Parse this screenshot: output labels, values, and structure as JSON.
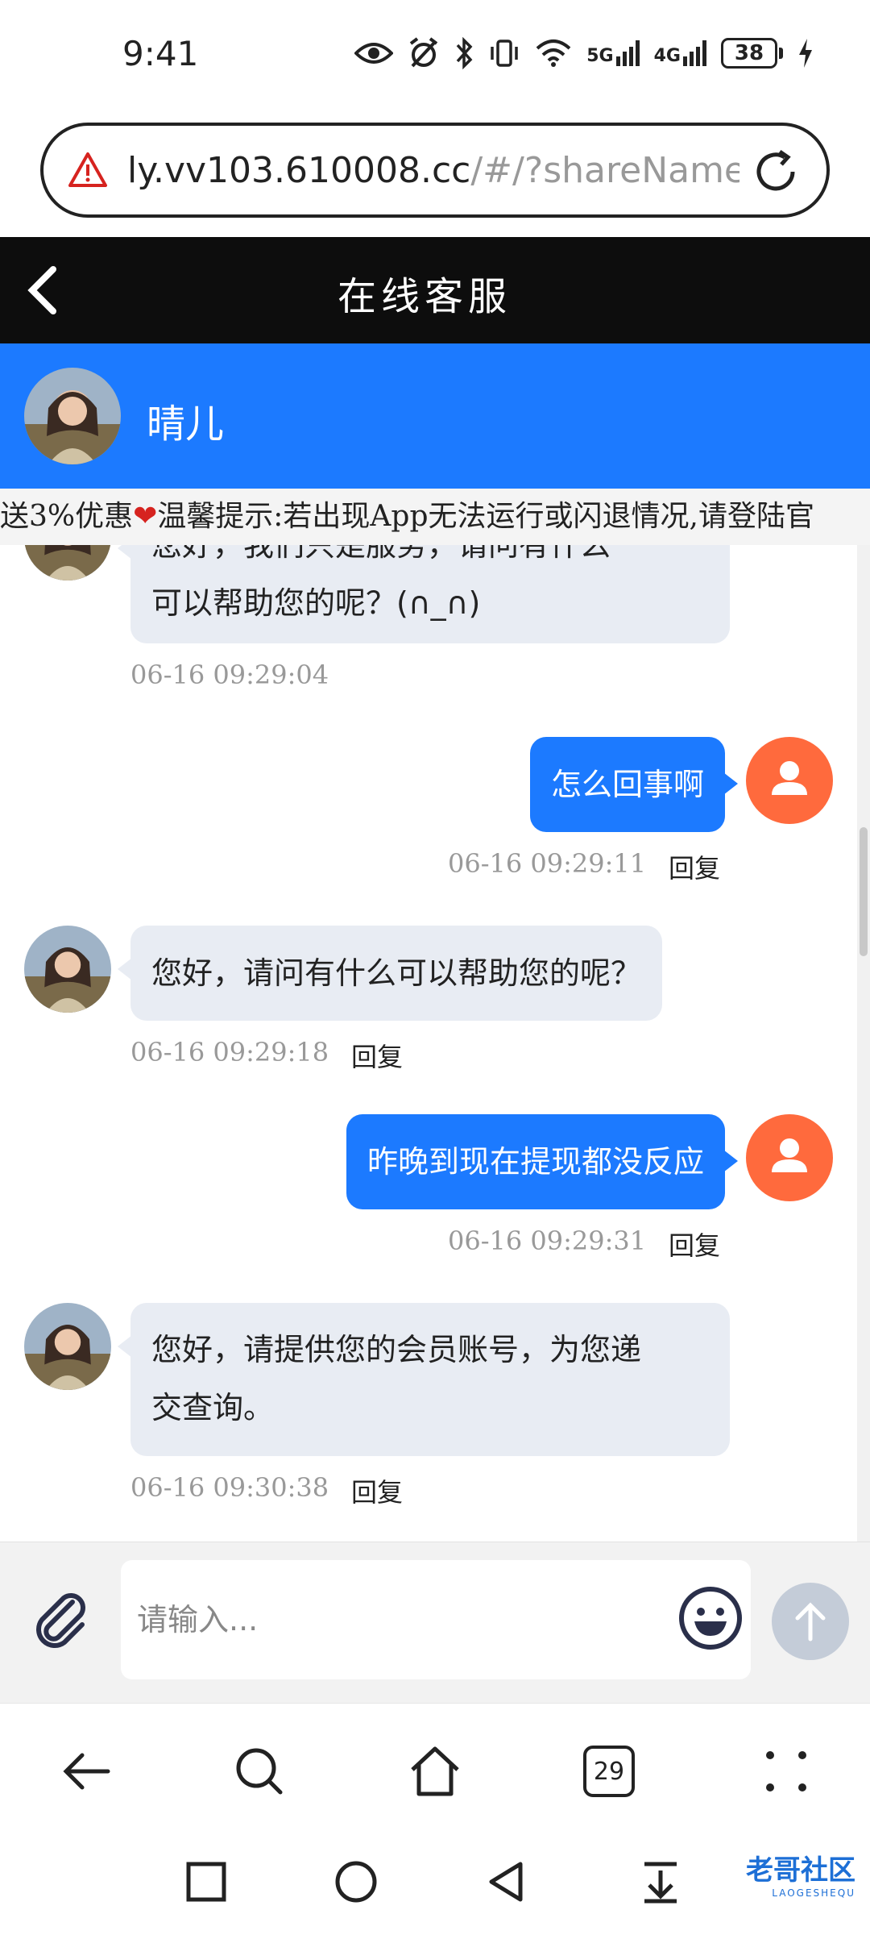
{
  "status_bar": {
    "time": "9:41",
    "net1": "5G",
    "net2": "4G",
    "battery": "38"
  },
  "url_bar": {
    "host": "ly.vv103.610008.cc",
    "path": "/#/?shareName"
  },
  "header": {
    "title": "在线客服"
  },
  "agent": {
    "name": "晴儿"
  },
  "marquee": {
    "text_before": "送3%优惠",
    "text_after": "温馨提示:若出现App无法运行或闪退情况,请登陆官"
  },
  "messages": [
    {
      "side": "in",
      "lines": [
        "您好，我们只是服务，请问有什么",
        "可以帮助您的呢？(∩_∩)"
      ],
      "time": "06-16 09:29:04",
      "reply": ""
    },
    {
      "side": "out",
      "text": "怎么回事啊",
      "time": "06-16 09:29:11",
      "reply": "回复"
    },
    {
      "side": "in",
      "lines": [
        "您好，请问有什么可以帮助您的呢？"
      ],
      "time": "06-16 09:29:18",
      "reply": "回复"
    },
    {
      "side": "out",
      "text": "昨晚到现在提现都没反应",
      "time": "06-16 09:29:31",
      "reply": "回复"
    },
    {
      "side": "in",
      "lines": [
        "您好，请提供您的会员账号，为您递",
        "交查询。"
      ],
      "time": "06-16 09:30:38",
      "reply": "回复"
    }
  ],
  "input": {
    "placeholder": "请输入..."
  },
  "browser_nav": {
    "tabs_count": "29"
  },
  "watermark": {
    "text": "老哥社区",
    "sub": "LAOGESHEQU"
  },
  "colors": {
    "accent_blue": "#1c7aff",
    "user_avatar": "#ff6a3d",
    "header_bg": "#0d0d0d",
    "warning_red": "#d6231f"
  }
}
